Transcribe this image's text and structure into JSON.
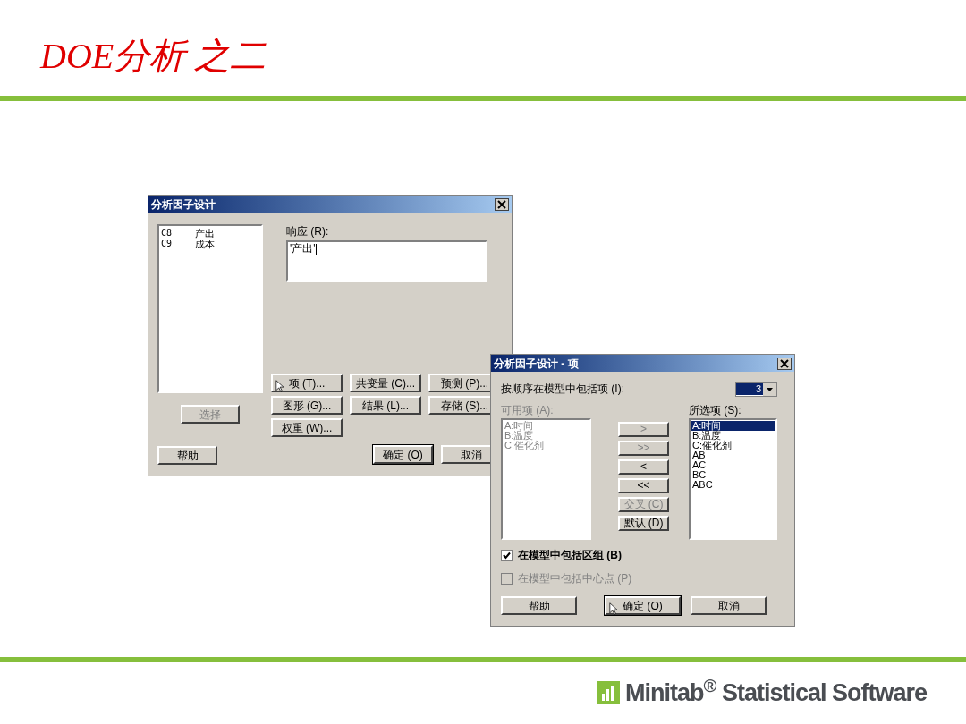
{
  "slide": {
    "title": "DOE分析 之二",
    "brand": "Minitab$^{®}$ Statistical Software"
  },
  "main_dialog": {
    "title": "分析因子设计",
    "columns": [
      {
        "id": "C8",
        "name": "产出"
      },
      {
        "id": "C9",
        "name": "成本"
      }
    ],
    "response_label": "响应 (R):",
    "response_value": "'产出'",
    "select_button": {
      "label": "选择",
      "disabled": true
    },
    "option_buttons": [
      {
        "label": "项 (T)...",
        "hovered": true
      },
      {
        "label": "共变量 (C)...",
        "hovered": false
      },
      {
        "label": "预测 (P)...",
        "hovered": false
      },
      {
        "label": "图形 (G)...",
        "hovered": false
      },
      {
        "label": "结果 (L)...",
        "hovered": false
      },
      {
        "label": "存储 (S)...",
        "hovered": false
      },
      {
        "label": "权重 (W)...",
        "hovered": false
      }
    ],
    "footer_buttons": [
      {
        "label": "帮助",
        "default": false,
        "hovered": false
      },
      {
        "label": "确定 (O)",
        "default": true,
        "hovered": false
      },
      {
        "label": "取消",
        "default": false,
        "hovered": false
      }
    ]
  },
  "terms_dialog": {
    "title": "分析因子设计 - 项",
    "order_label": "按顺序在模型中包括项 (I):",
    "order_value": "3",
    "available_label": "可用项 (A):",
    "available_disabled": true,
    "available": [
      {
        "label": "A:时间"
      },
      {
        "label": "B:温度"
      },
      {
        "label": "C:催化剂"
      }
    ],
    "move_buttons": [
      {
        "label": ">",
        "disabled": true
      },
      {
        "label": ">>",
        "disabled": true
      },
      {
        "label": "<",
        "disabled": false
      },
      {
        "label": "<<",
        "disabled": false
      },
      {
        "label": "交叉 (C)",
        "disabled": true
      },
      {
        "label": "默认 (D)",
        "disabled": false
      }
    ],
    "selected_label": "所选项 (S):",
    "selected_terms": [
      {
        "label": "A:时间",
        "selected": true
      },
      {
        "label": "B:温度",
        "selected": false
      },
      {
        "label": "C:催化剂",
        "selected": false
      },
      {
        "label": "AB",
        "selected": false
      },
      {
        "label": "AC",
        "selected": false
      },
      {
        "label": "BC",
        "selected": false
      },
      {
        "label": "ABC",
        "selected": false
      }
    ],
    "checkboxes": [
      {
        "label": "在模型中包括区组 (B)",
        "checked": true,
        "disabled": false
      },
      {
        "label": "在模型中包括中心点 (P)",
        "checked": false,
        "disabled": true
      }
    ],
    "footer_buttons": [
      {
        "label": "帮助",
        "default": false,
        "hovered": false
      },
      {
        "label": "确定 (O)",
        "default": true,
        "hovered": true
      },
      {
        "label": "取消",
        "default": false,
        "hovered": false
      }
    ]
  }
}
